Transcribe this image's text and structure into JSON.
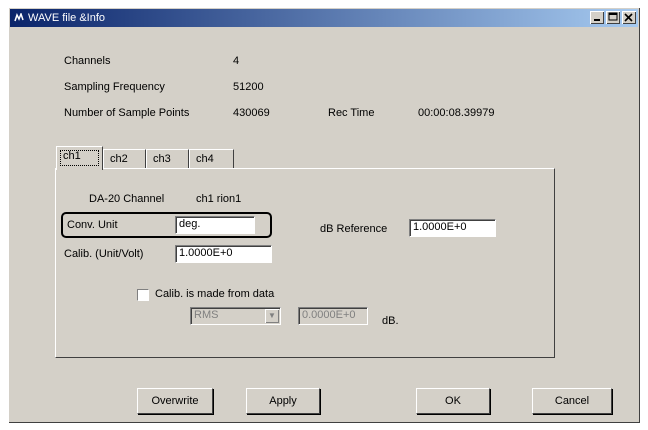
{
  "window": {
    "title": "WAVE file &Info"
  },
  "info": {
    "channels_label": "Channels",
    "channels_value": "4",
    "sampling_label": "Sampling Frequency",
    "sampling_value": "51200",
    "points_label": "Number of Sample Points",
    "points_value": "430069",
    "rectime_label": "Rec Time",
    "rectime_value": "00:00:08.39979"
  },
  "tabs": [
    {
      "label": "ch1",
      "active": true
    },
    {
      "label": "ch2",
      "active": false
    },
    {
      "label": "ch3",
      "active": false
    },
    {
      "label": "ch4",
      "active": false
    }
  ],
  "panel": {
    "da_label": "DA-20 Channel",
    "da_value": "ch1 rion1",
    "conv_unit_label": "Conv. Unit",
    "conv_unit_value": "deg.",
    "db_ref_label": "dB Reference",
    "db_ref_value": "1.0000E+0",
    "calib_label": "Calib. (Unit/Volt)",
    "calib_value": "1.0000E+0",
    "calib_from_data_label": "Calib. is made from data",
    "calib_from_data_checked": false,
    "rms_select": "RMS",
    "db_value": "0.0000E+0",
    "db_unit": "dB."
  },
  "buttons": {
    "overwrite": "Overwrite",
    "apply": "Apply",
    "ok": "OK",
    "cancel": "Cancel"
  },
  "colors": {
    "titlebar_start": "#0a246a",
    "titlebar_end": "#a6caf0",
    "face": "#d4d0c8"
  }
}
